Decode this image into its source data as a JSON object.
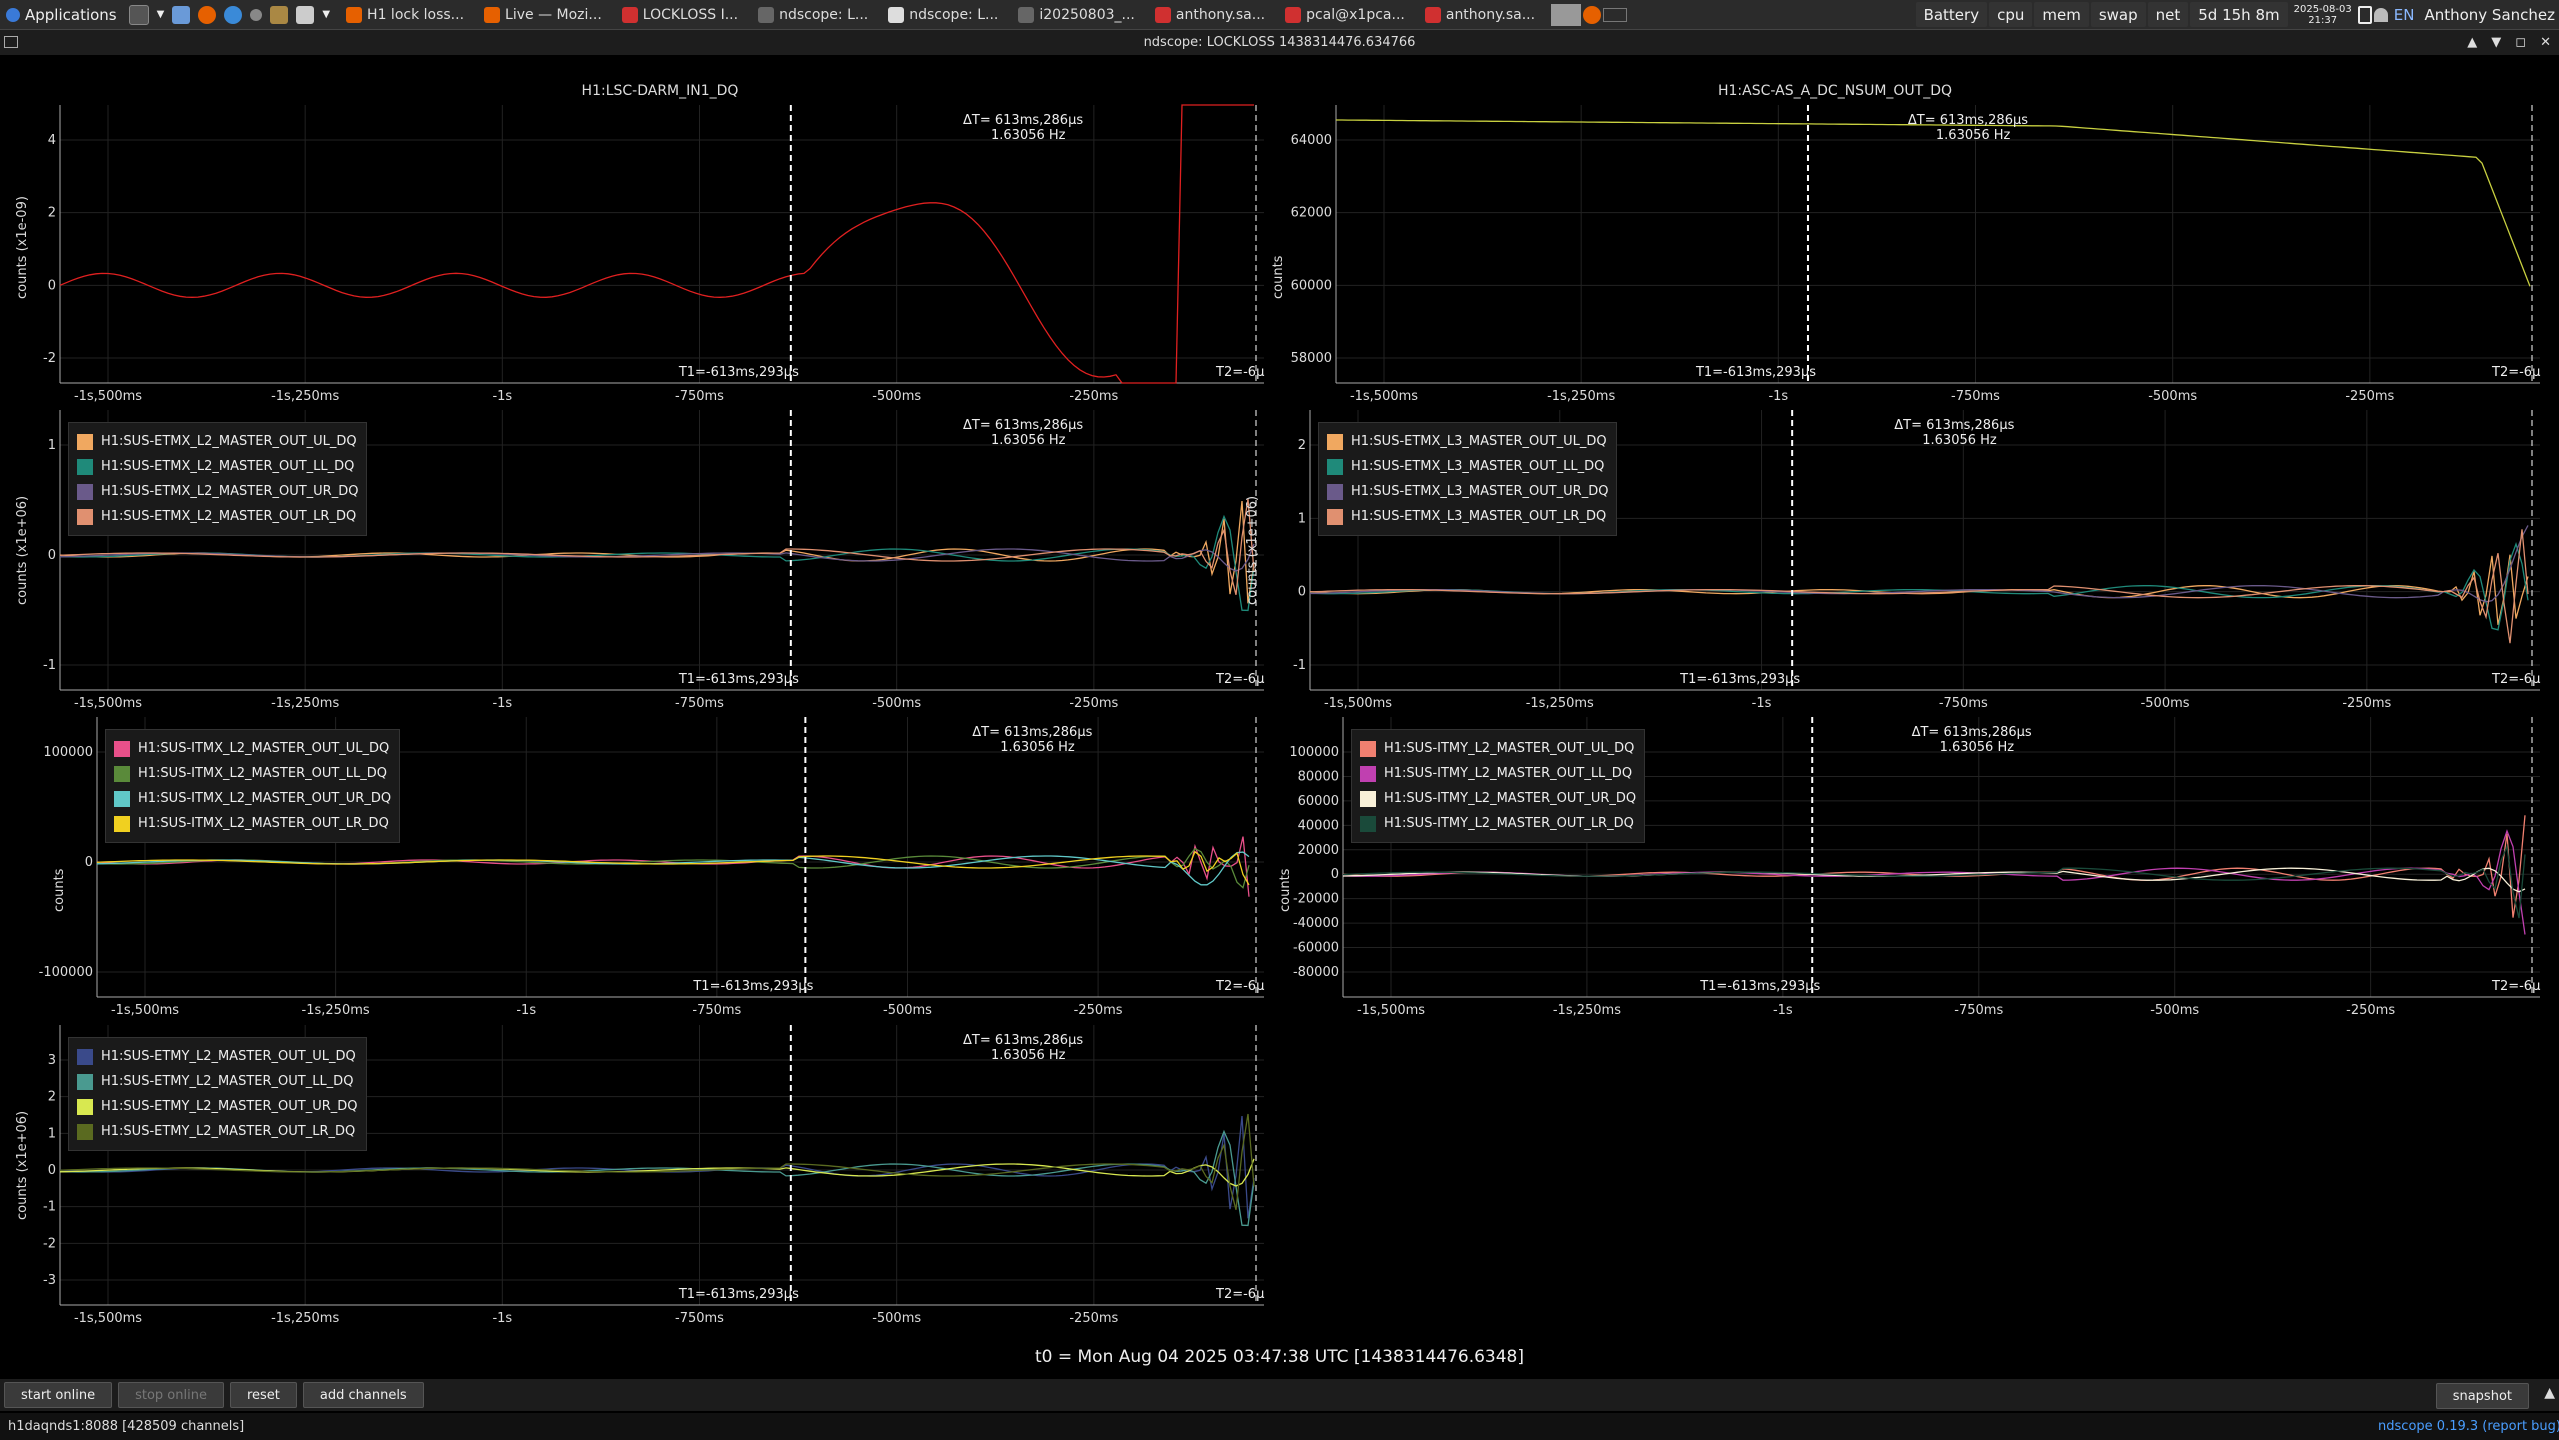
{
  "taskbar": {
    "apps_label": "Applications",
    "tasks": [
      {
        "label": "H1 lock loss...",
        "color": "#e66000"
      },
      {
        "label": "Live — Mozi...",
        "color": "#e66000"
      },
      {
        "label": "LOCKLOSS I...",
        "color": "#d03030"
      },
      {
        "label": "ndscope: L...",
        "color": "#666666"
      },
      {
        "label": "ndscope: L...",
        "color": "#dddddd"
      },
      {
        "label": "i20250803_...",
        "color": "#666666"
      },
      {
        "label": "anthony.sa...",
        "color": "#d03030"
      },
      {
        "label": "pcal@x1pca...",
        "color": "#d03030"
      },
      {
        "label": "anthony.sa...",
        "color": "#d03030"
      }
    ],
    "tray": {
      "battery": "Battery",
      "cpu": "cpu",
      "mem": "mem",
      "swap": "swap",
      "net": "net",
      "uptime": "5d 15h 8m",
      "date": "2025-08-03",
      "time": "21:37",
      "lang": "EN",
      "user": "Anthony Sanchez"
    }
  },
  "window": {
    "title": "ndscope: LOCKLOSS 1438314476.634766",
    "controls": [
      "▲",
      "▼",
      "◻",
      "✕"
    ]
  },
  "cursors": {
    "delta_label": "ΔT=",
    "delta_value": "613ms,286µs",
    "freq": "1.63056 Hz",
    "t1": "T1=-613ms,293µs",
    "t2": "T2=-6µ"
  },
  "x_ticks": [
    "-1s,500ms",
    "-1s,250ms",
    "-1s",
    "-750ms",
    "-500ms",
    "-250ms"
  ],
  "plots": [
    {
      "id": "p1",
      "title": "H1:LSC-DARM_IN1_DQ",
      "ylabel": "counts (x1e-09)",
      "yticks": [
        "4",
        "2",
        "0",
        "-2"
      ],
      "legend": []
    },
    {
      "id": "p2",
      "title": "H1:ASC-AS_A_DC_NSUM_OUT_DQ",
      "ylabel": "counts",
      "yticks": [
        "64000",
        "62000",
        "60000",
        "58000"
      ],
      "legend": []
    },
    {
      "id": "p3",
      "title": "",
      "ylabel": "counts (x1e+06)",
      "yticks": [
        "1",
        "0",
        "-1"
      ],
      "legend": [
        {
          "name": "H1:SUS-ETMX_L2_MASTER_OUT_UL_DQ",
          "color": "#f0a860"
        },
        {
          "name": "H1:SUS-ETMX_L2_MASTER_OUT_LL_DQ",
          "color": "#1f8a7a"
        },
        {
          "name": "H1:SUS-ETMX_L2_MASTER_OUT_UR_DQ",
          "color": "#6a5a8a"
        },
        {
          "name": "H1:SUS-ETMX_L2_MASTER_OUT_LR_DQ",
          "color": "#e09070"
        }
      ]
    },
    {
      "id": "p4",
      "title": "",
      "ylabel": "counts (x1e+06)",
      "yticks": [
        "2",
        "1",
        "0",
        "-1"
      ],
      "legend": [
        {
          "name": "H1:SUS-ETMX_L3_MASTER_OUT_UL_DQ",
          "color": "#f0a860"
        },
        {
          "name": "H1:SUS-ETMX_L3_MASTER_OUT_LL_DQ",
          "color": "#1f8a7a"
        },
        {
          "name": "H1:SUS-ETMX_L3_MASTER_OUT_UR_DQ",
          "color": "#6a5a8a"
        },
        {
          "name": "H1:SUS-ETMX_L3_MASTER_OUT_LR_DQ",
          "color": "#e09070"
        }
      ]
    },
    {
      "id": "p5",
      "title": "",
      "ylabel": "counts",
      "yticks": [
        "100000",
        "0",
        "-100000"
      ],
      "legend": [
        {
          "name": "H1:SUS-ITMX_L2_MASTER_OUT_UL_DQ",
          "color": "#e8508a"
        },
        {
          "name": "H1:SUS-ITMX_L2_MASTER_OUT_LL_DQ",
          "color": "#5a8a3a"
        },
        {
          "name": "H1:SUS-ITMX_L2_MASTER_OUT_UR_DQ",
          "color": "#60c8c8"
        },
        {
          "name": "H1:SUS-ITMX_L2_MASTER_OUT_LR_DQ",
          "color": "#f0d020"
        }
      ]
    },
    {
      "id": "p6",
      "title": "",
      "ylabel": "counts",
      "yticks": [
        "100000",
        "80000",
        "60000",
        "40000",
        "20000",
        "0",
        "-20000",
        "-40000",
        "-60000",
        "-80000"
      ],
      "legend": [
        {
          "name": "H1:SUS-ITMY_L2_MASTER_OUT_UL_DQ",
          "color": "#f08070"
        },
        {
          "name": "H1:SUS-ITMY_L2_MASTER_OUT_LL_DQ",
          "color": "#c040b0"
        },
        {
          "name": "H1:SUS-ITMY_L2_MASTER_OUT_UR_DQ",
          "color": "#f8f0d8"
        },
        {
          "name": "H1:SUS-ITMY_L2_MASTER_OUT_LR_DQ",
          "color": "#1a4a3a"
        }
      ]
    },
    {
      "id": "p7",
      "title": "",
      "ylabel": "counts (x1e+06)",
      "yticks": [
        "3",
        "2",
        "1",
        "0",
        "-1",
        "-2",
        "-3"
      ],
      "legend": [
        {
          "name": "H1:SUS-ETMY_L2_MASTER_OUT_UL_DQ",
          "color": "#3a4a8a"
        },
        {
          "name": "H1:SUS-ETMY_L2_MASTER_OUT_LL_DQ",
          "color": "#4a9a90"
        },
        {
          "name": "H1:SUS-ETMY_L2_MASTER_OUT_UR_DQ",
          "color": "#d8e850"
        },
        {
          "name": "H1:SUS-ETMY_L2_MASTER_OUT_LR_DQ",
          "color": "#5a6a20"
        }
      ]
    }
  ],
  "t0_label": "t0 = Mon Aug 04 2025 03:47:38 UTC [1438314476.6348]",
  "buttons": {
    "start_online": "start online",
    "stop_online": "stop online",
    "reset": "reset",
    "add_channels": "add channels",
    "snapshot": "snapshot"
  },
  "status": {
    "server": "h1daqnds1:8088  [428509 channels]",
    "version": "ndscope 0.19.3 (report bug)"
  }
}
